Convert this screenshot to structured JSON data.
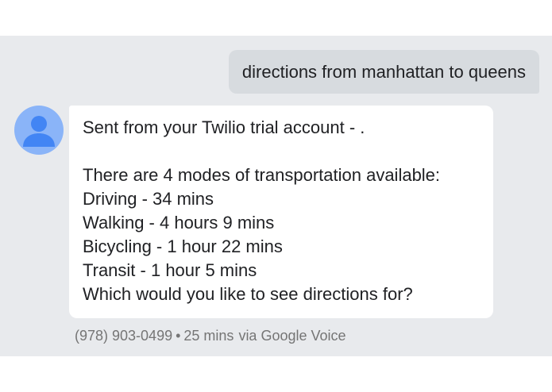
{
  "conversation": {
    "outgoing_message": "directions from manhattan to queens",
    "incoming_message": {
      "lines": [
        "Sent from your Twilio trial account - .",
        "",
        "There are 4 modes of transportation available:",
        "Driving - 34 mins",
        "Walking - 4 hours 9 mins",
        "Bicycling - 1 hour 22 mins",
        "Transit - 1 hour 5 mins",
        "Which would you like to see directions for?"
      ],
      "avatar_icon": "person-icon"
    },
    "meta": {
      "phone": "(978) 903-0499",
      "separator": "•",
      "time": "25 mins",
      "via": "via Google Voice"
    }
  },
  "colors": {
    "thread_background": "#e8eaed",
    "outgoing_bubble": "#d7dbdf",
    "incoming_bubble": "#ffffff",
    "avatar_background": "#8ab4f8",
    "avatar_figure": "#4285f4",
    "meta_text": "#757575"
  }
}
